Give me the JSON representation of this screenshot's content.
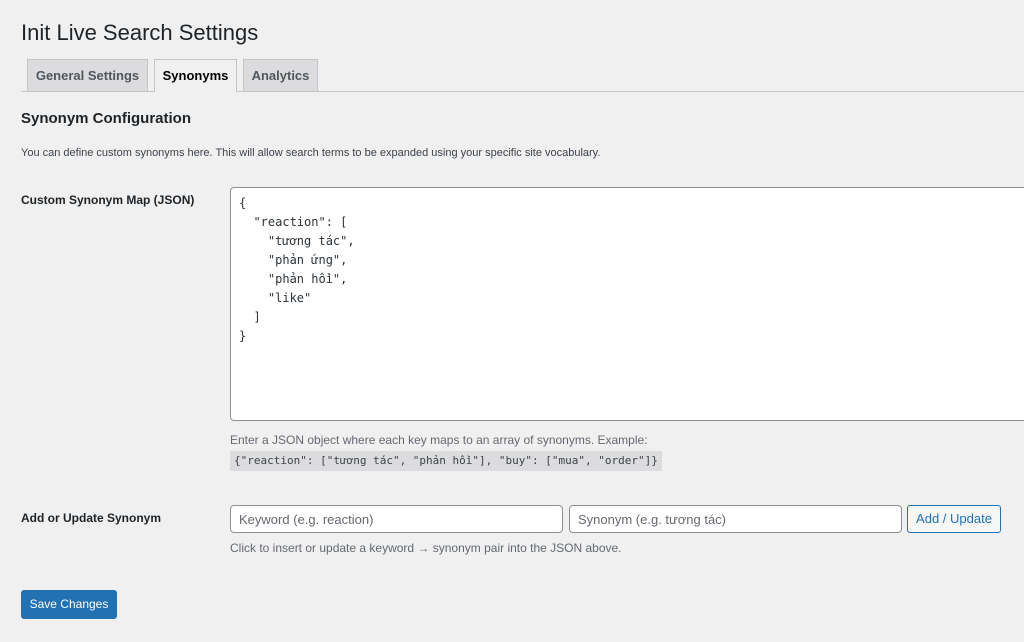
{
  "page": {
    "title": "Init Live Search Settings"
  },
  "tabs": [
    {
      "label": "General Settings",
      "active": false
    },
    {
      "label": "Synonyms",
      "active": true
    },
    {
      "label": "Analytics",
      "active": false
    }
  ],
  "section": {
    "title": "Synonym Configuration",
    "description": "You can define custom synonyms here. This will allow search terms to be expanded using your specific site vocabulary."
  },
  "synonym_map": {
    "label": "Custom Synonym Map (JSON)",
    "value": "{\n  \"reaction\": [\n    \"tương tác\",\n    \"phản ứng\",\n    \"phản hồi\",\n    \"like\"\n  ]\n}",
    "hint": "Enter a JSON object where each key maps to an array of synonyms. Example:",
    "example": "{\"reaction\": [\"tương tác\", \"phản hồi\"], \"buy\": [\"mua\", \"order\"]}"
  },
  "add_synonym": {
    "label": "Add or Update Synonym",
    "keyword_placeholder": "Keyword (e.g. reaction)",
    "synonym_placeholder": "Synonym (e.g. tương tác)",
    "button_label": "Add / Update",
    "hint": "Click to insert or update a keyword → synonym pair into the JSON above."
  },
  "actions": {
    "save_label": "Save Changes"
  },
  "colors": {
    "background": "#f0f0f1",
    "primary": "#2271b1",
    "tab_inactive": "#dcdcde",
    "border": "#c3c4c7"
  }
}
